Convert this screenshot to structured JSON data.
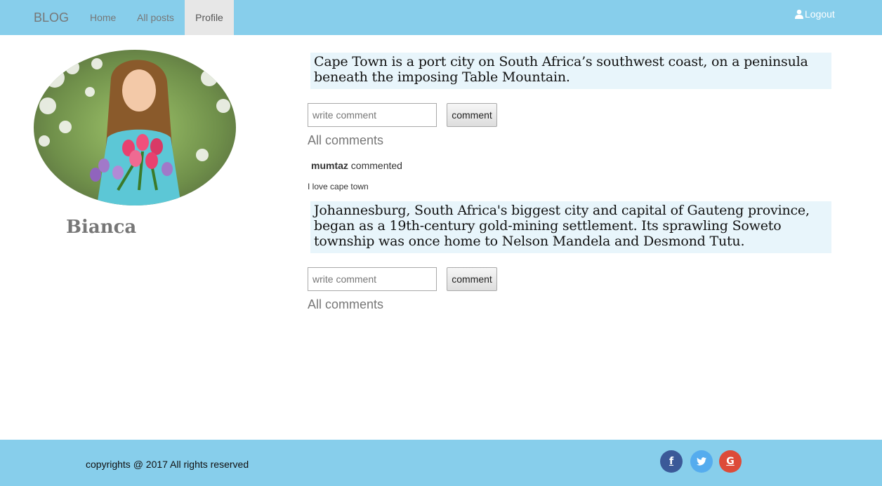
{
  "navbar": {
    "brand": "BLOG",
    "items": [
      {
        "label": "Home"
      },
      {
        "label": "All posts"
      },
      {
        "label": "Profile",
        "active": true
      }
    ],
    "logout": "Logout",
    "background_color": "#87ceeb"
  },
  "profile": {
    "name": "Bianca",
    "avatar_icon": "girl-with-tulips-photo"
  },
  "posts": [
    {
      "text": "Cape Town is a port city on South Africa’s southwest coast, on a peninsula beneath the imposing Table Mountain.",
      "comment_placeholder": "write comment",
      "comment_button": "comment",
      "all_comments_label": "All comments",
      "comments": [
        {
          "author": "mumtaz",
          "action": "commented",
          "text": "I love cape town"
        }
      ]
    },
    {
      "text": "Johannesburg, South Africa's biggest city and capital of Gauteng province, began as a 19th-century gold-mining settlement. Its sprawling Soweto township was once home to Nelson Mandela and Desmond Tutu.",
      "comment_placeholder": "write comment",
      "comment_button": "comment",
      "all_comments_label": "All comments",
      "comments": []
    }
  ],
  "footer": {
    "copyright": "copyrights @ 2017 All rights reserved",
    "social": [
      {
        "icon": "facebook-icon",
        "glyph": "f",
        "color": "#3b5998"
      },
      {
        "icon": "twitter-icon",
        "glyph": "t",
        "color": "#55acee"
      },
      {
        "icon": "google-icon",
        "glyph": "G",
        "color": "#dd4b39"
      }
    ]
  }
}
